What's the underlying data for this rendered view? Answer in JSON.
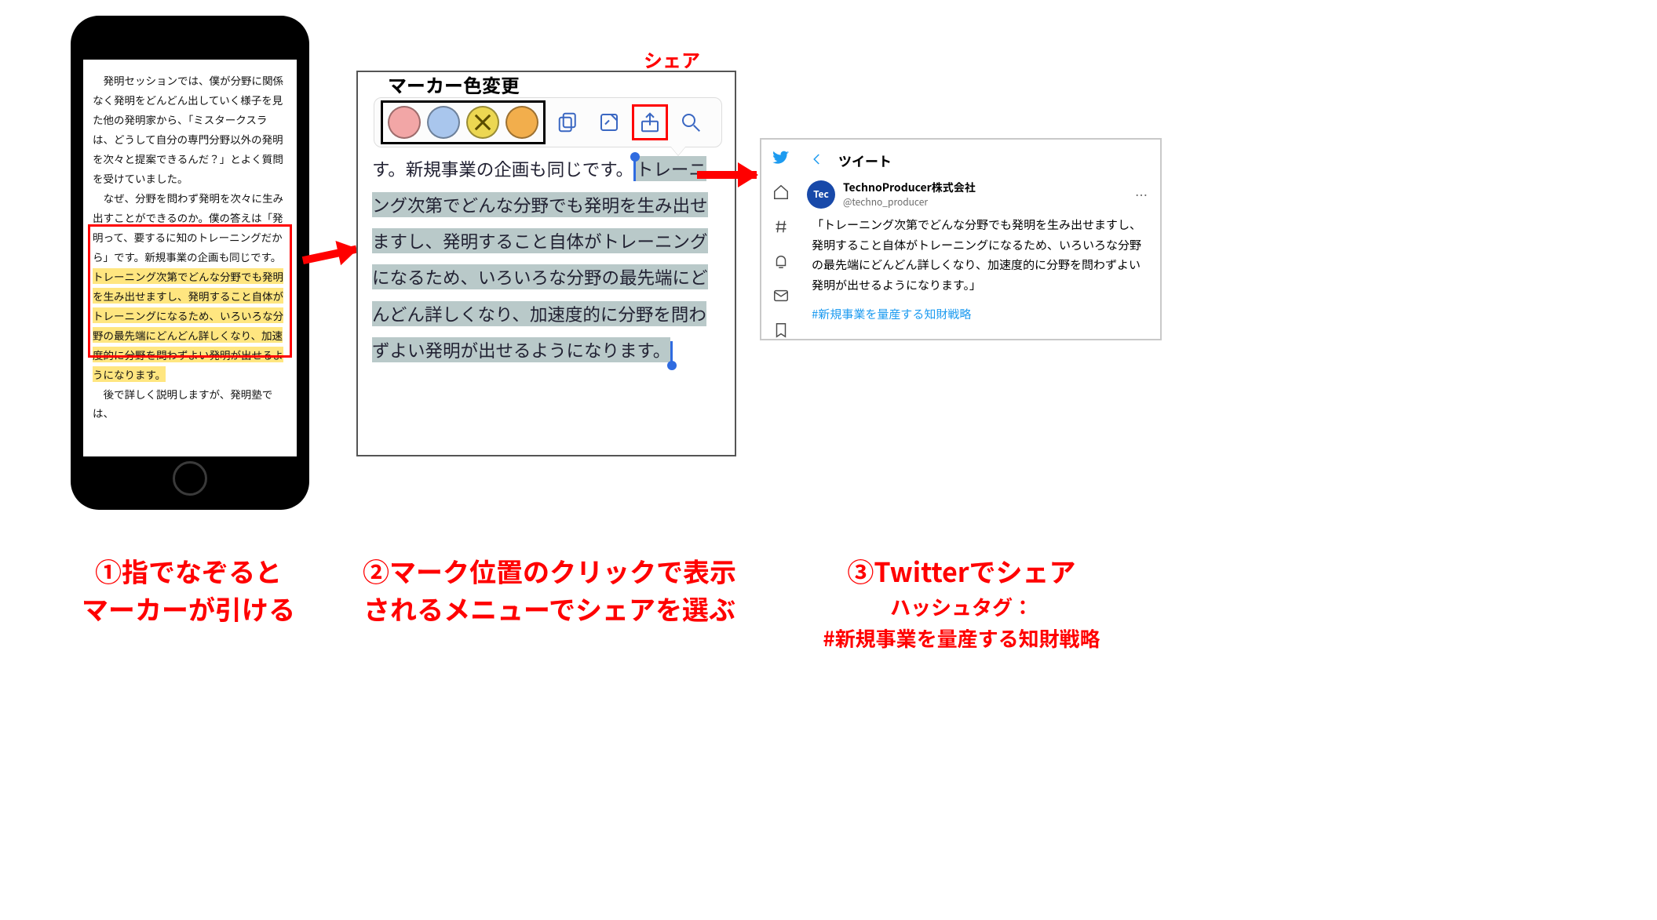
{
  "step1": {
    "para1": "発明セッションでは、僕が分野に関係なく発明をどんどん出していく様子を見た他の発明家から、「ミスタークスラは、どうして自分の専門分野以外の発明を次々と提案できるんだ？」とよく質問を受けていました。",
    "para2": "なぜ、分野を問わず発明を次々に生み出すことができるのか。僕の答えは「発明って、要するに知のトレーニングだから」です。新規事業の企画も同じです。",
    "highlight": "トレーニング次第でどんな分野でも発明を生み出せますし、発明すること自体がトレーニングになるため、いろいろな分野の最先端にどんどん詳しくなり、加速度的に分野を問わずよい発明が出せるようになります。",
    "para3": "後で詳しく説明しますが、発明塾では、"
  },
  "step2": {
    "label_color": "マーカー色変更",
    "label_share": "シェア",
    "pretext": "す。新規事業の企画も同じです。",
    "selection": "トレーニング次第でどんな分野でも発明を生み出せますし、発明すること自体がトレーニングになるため、いろいろな分野の最先端にどんどん詳しくなり、加速度的に分野を問わずよい発明が出せるようになります。"
  },
  "step3": {
    "title": "ツイート",
    "avatar": "Tec",
    "display_name": "TechnoProducer株式会社",
    "handle": "@techno_producer",
    "body": "「トレーニング次第でどんな分野でも発明を生み出せますし、発明すること自体がトレーニングになるため、いろいろな分野の最先端にどんどん詳しくなり、加速度的に分野を問わずよい発明が出せるようになります。」",
    "hashtag": "#新規事業を量産する知財戦略"
  },
  "captions": {
    "c1": "①指でなぞると\nマーカーが引ける",
    "c2": "②マーク位置のクリックで表示されるメニューでシェアを選ぶ",
    "c3_main": "③Twitterでシェア",
    "c3_sub1": "ハッシュタグ：",
    "c3_sub2": "#新規事業を量産する知財戦略"
  }
}
